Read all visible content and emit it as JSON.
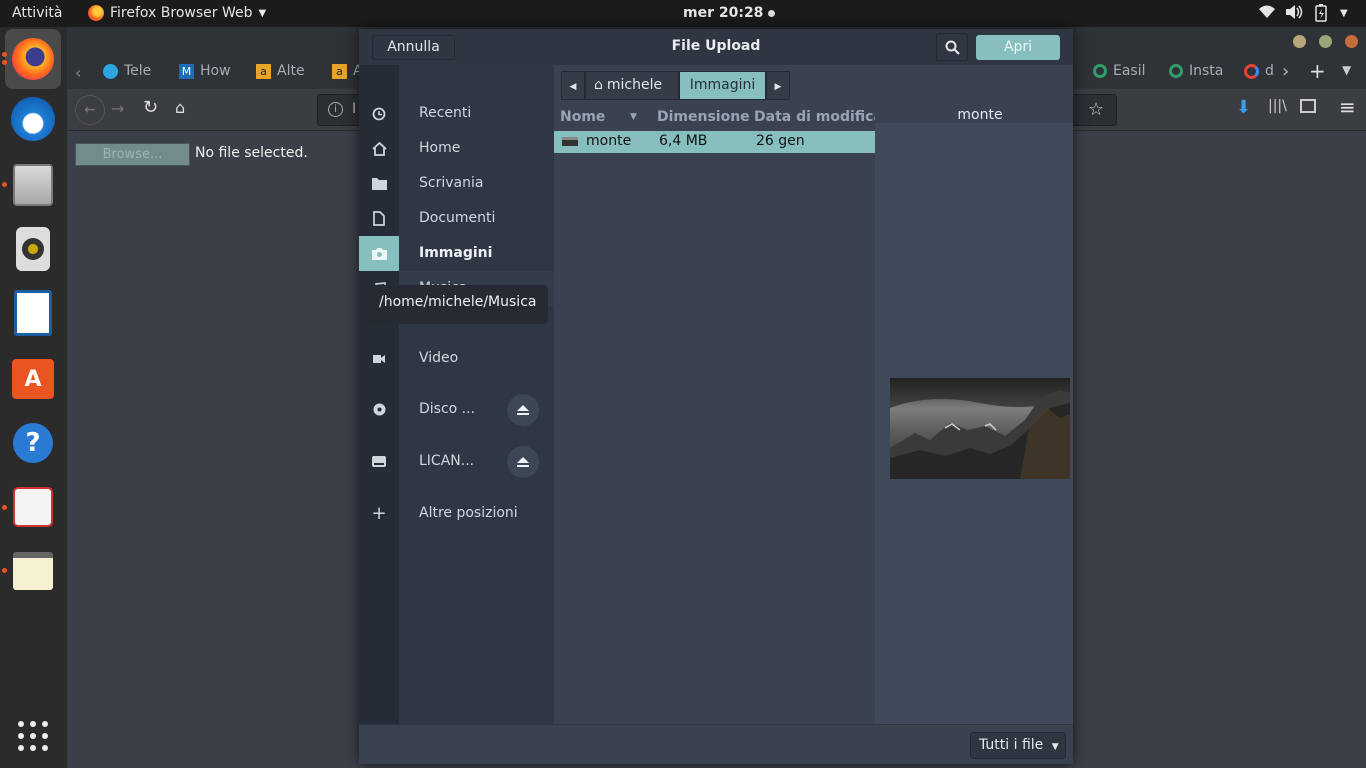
{
  "topbar": {
    "activities": "Attività",
    "app_menu": "Firefox Browser Web",
    "clock": "mer 20:28"
  },
  "dock": {
    "apps": [
      "firefox",
      "thunderbird",
      "files",
      "rhythmbox",
      "libreoffice-writer",
      "ubuntu-software",
      "help",
      "document-viewer",
      "text-editor",
      "show-applications"
    ]
  },
  "firefox": {
    "tabs": [
      {
        "label": "Tele"
      },
      {
        "label": "How"
      },
      {
        "label": "Alte"
      },
      {
        "label": "A"
      },
      {
        "label": "Easil"
      },
      {
        "label": "Insta"
      },
      {
        "label": "d"
      }
    ],
    "url_fragment": "I",
    "page": {
      "browse_label": "Browse...",
      "no_file": "No file selected."
    }
  },
  "dialog": {
    "title": "File Upload",
    "cancel": "Annulla",
    "open": "Apri",
    "places": [
      {
        "label": "Recenti",
        "icon": "clock-icon"
      },
      {
        "label": "Home",
        "icon": "home-icon"
      },
      {
        "label": "Scrivania",
        "icon": "folder-icon"
      },
      {
        "label": "Documenti",
        "icon": "document-icon"
      },
      {
        "label": "Immagini",
        "icon": "camera-icon",
        "selected": true
      },
      {
        "label": "Musica",
        "icon": "music-icon"
      },
      {
        "label": "Video",
        "icon": "video-icon"
      },
      {
        "label": "Disco ...",
        "icon": "disc-icon",
        "ejectable": true
      },
      {
        "label": "LICAN...",
        "icon": "drive-icon",
        "ejectable": true
      },
      {
        "label": "Altre posizioni",
        "icon": "plus-icon"
      }
    ],
    "path": [
      "michele",
      "Immagini"
    ],
    "columns": [
      "Nome",
      "Dimensione",
      "Data di modifica"
    ],
    "files": [
      {
        "name": "monte",
        "size": "6,4 MB",
        "date": "26 gen"
      }
    ],
    "preview_title": "monte",
    "filter": "Tutti i file",
    "tooltip": "/home/michele/Musica"
  }
}
